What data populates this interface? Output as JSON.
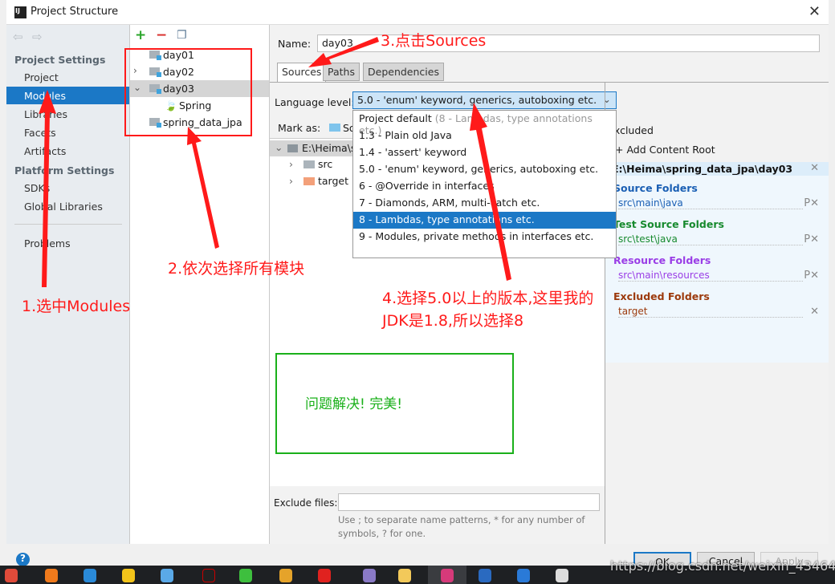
{
  "window": {
    "title": "Project Structure",
    "logo": "IJ"
  },
  "sidebar": {
    "sections": [
      {
        "label": "Project Settings",
        "items": [
          "Project",
          "Modules",
          "Libraries",
          "Facets",
          "Artifacts"
        ]
      },
      {
        "label": "Platform Settings",
        "items": [
          "SDKs",
          "Global Libraries"
        ]
      }
    ],
    "problems": "Problems",
    "selected": "Modules"
  },
  "modules": {
    "items": [
      "day01",
      "day02",
      "day03",
      "Spring",
      "spring_data_jpa"
    ],
    "selected": "day03"
  },
  "main": {
    "name_label": "Name:",
    "name_value": "day03",
    "tabs": [
      "Sources",
      "Paths",
      "Dependencies"
    ],
    "active_tab": "Sources",
    "language_label": "Language level:",
    "language_value": "5.0 - 'enum' keyword, generics, autoboxing etc.",
    "mark_as_label": "Mark as:",
    "mark_as_first": "Sources",
    "excluded_label": "Excluded",
    "tree": {
      "root": "E:\\Heima\\spring_data_jpa\\day03",
      "children": [
        "src",
        "target"
      ]
    },
    "exclude_label": "Exclude files:",
    "exclude_value": "",
    "exclude_hint": "Use ; to separate name patterns, * for any number of symbols, ? for one."
  },
  "dropdown": {
    "options": [
      {
        "label": "Project default",
        "hint": "(8 - Lambdas, type annotations etc.)"
      },
      {
        "label": "1.3 - Plain old Java"
      },
      {
        "label": "1.4 - 'assert' keyword"
      },
      {
        "label": "5.0 - 'enum' keyword, generics, autoboxing etc."
      },
      {
        "label": "6 - @Override in interfaces"
      },
      {
        "label": "7 - Diamonds, ARM, multi-catch etc."
      },
      {
        "label": "8 - Lambdas, type annotations etc."
      },
      {
        "label": "9 - Modules, private methods in interfaces etc."
      }
    ],
    "highlighted": "8 - Lambdas, type annotations etc."
  },
  "content_root": {
    "add_label": "+ Add Content Root",
    "path": "E:\\Heima\\spring_data_jpa\\day03",
    "groups": [
      {
        "title": "Source Folders",
        "path": "src\\main\\java",
        "color": "#1a5fb4"
      },
      {
        "title": "Test Source Folders",
        "path": "src\\test\\java",
        "color": "#178a2e"
      },
      {
        "title": "Resource Folders",
        "path": "src\\main\\resources",
        "color": "#9a3ee6"
      },
      {
        "title": "Excluded Folders",
        "path": "target",
        "color": "#9c3a0c"
      }
    ]
  },
  "buttons": {
    "ok": "OK",
    "cancel": "Cancel",
    "apply": "Apply",
    "help": "?"
  },
  "annotations": {
    "step1": "1.选中Modules",
    "step2": "2.依次选择所有模块",
    "step3": "3.点击Sources",
    "step4_line1": "4.选择5.0以上的版本,这里我的",
    "step4_line2": "JDK是1.8,所以选择8",
    "result": "问题解决!  完美!",
    "annotation_color": "#ff1a1a",
    "result_color": "#1ab01a"
  },
  "watermark": "https://blog.csdn.net/weixin_43464964",
  "taskbar": {
    "icons": [
      "chrome-icon",
      "firefox-icon",
      "feather-icon",
      "browser-icon",
      "qq-browser-icon",
      "qq-icon",
      "wechat-icon",
      "phone-icon",
      "youdao-icon",
      "tool-icon",
      "folder-icon",
      "intellij-icon",
      "app-icon",
      "vpn-icon",
      "notepad-icon"
    ]
  }
}
